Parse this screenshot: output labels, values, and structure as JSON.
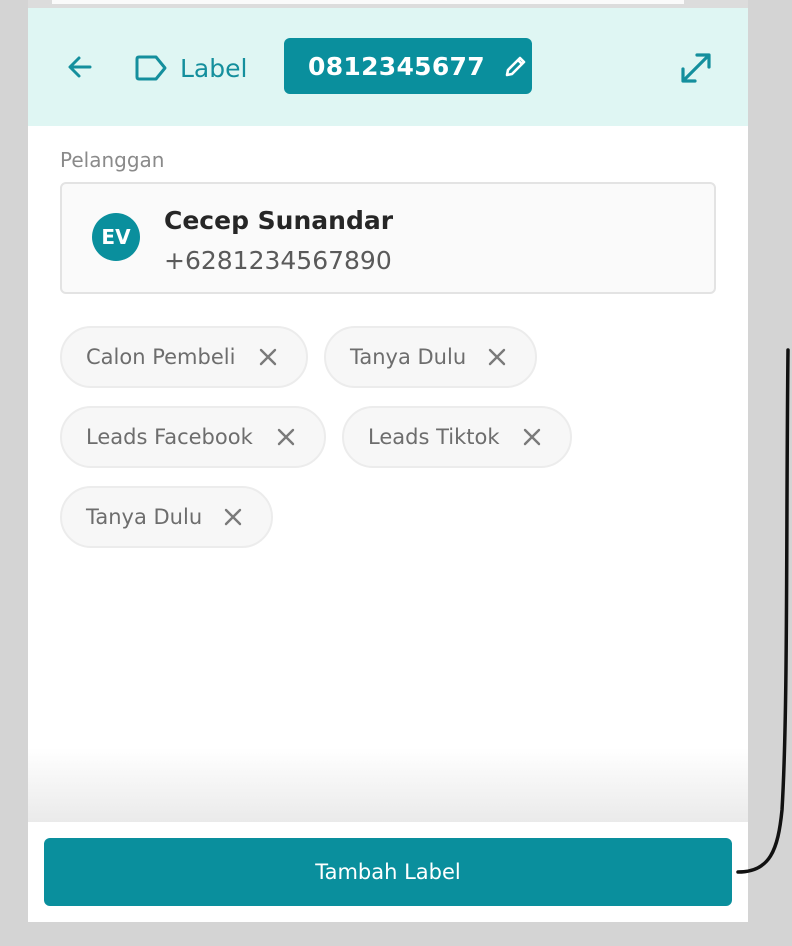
{
  "header": {
    "back_icon": "arrow-left-icon",
    "label_icon": "tag-outline-icon",
    "label_text": "Label",
    "phone_number": "0812345677",
    "edit_icon": "pencil-icon",
    "expand_icon": "expand-arrows-icon"
  },
  "customer": {
    "section_label": "Pelanggan",
    "avatar_initials": "EV",
    "name": "Cecep Sunandar",
    "phone": "+6281234567890"
  },
  "tags": [
    {
      "label": "Calon Pembeli"
    },
    {
      "label": "Tanya Dulu"
    },
    {
      "label": "Leads Facebook"
    },
    {
      "label": "Leads Tiktok"
    },
    {
      "label": "Tanya Dulu"
    }
  ],
  "footer": {
    "add_label_button": "Tambah Label"
  },
  "colors": {
    "accent": "#0a8f9d",
    "header_bg": "#dff6f3",
    "page_bg": "#d4d4d4"
  }
}
